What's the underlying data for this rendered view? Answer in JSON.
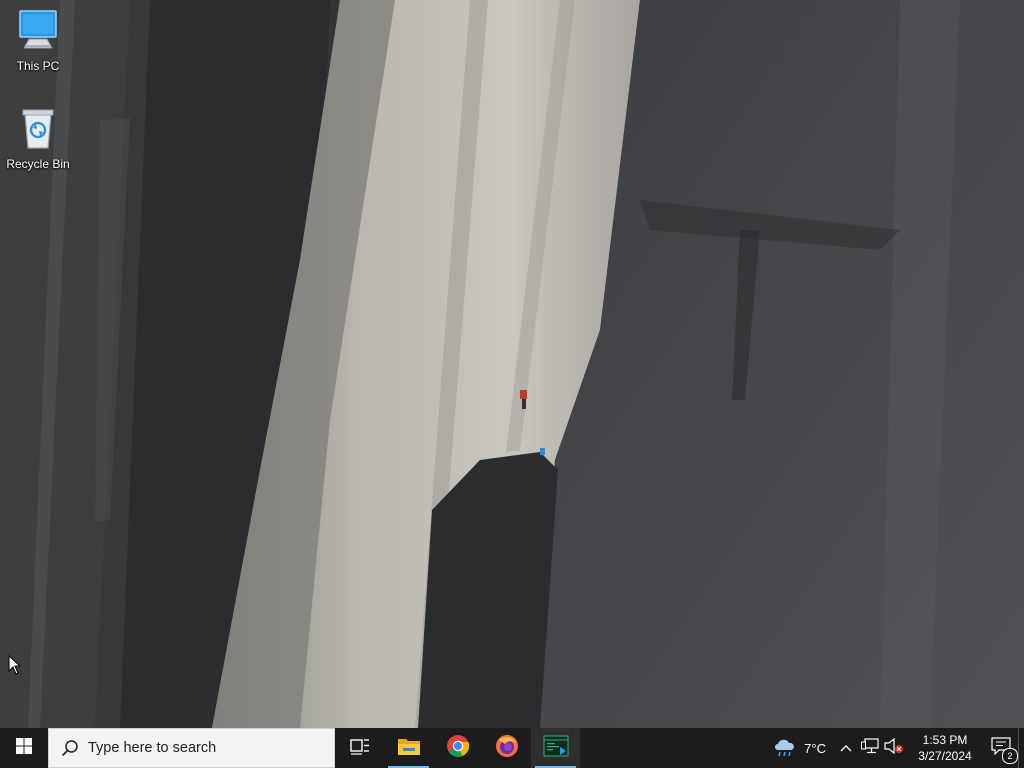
{
  "desktop": {
    "icons": [
      {
        "label": "This PC",
        "icon": "this-pc-icon"
      },
      {
        "label": "Recycle Bin",
        "icon": "recycle-bin-icon"
      }
    ]
  },
  "taskbar": {
    "search_placeholder": "Type here to search",
    "pinned": [
      {
        "name": "task-view",
        "icon": "task-view-icon"
      },
      {
        "name": "file-explorer",
        "icon": "file-explorer-icon",
        "open": true
      },
      {
        "name": "chrome",
        "icon": "chrome-icon"
      },
      {
        "name": "firefox",
        "icon": "firefox-icon"
      },
      {
        "name": "terminal",
        "icon": "terminal-icon",
        "open": true
      }
    ],
    "weather": {
      "temperature": "7°C",
      "icon": "cloud-rain-icon"
    },
    "clock": {
      "time": "1:53 PM",
      "date": "3/27/2024"
    },
    "notifications": {
      "count": "2"
    }
  },
  "colors": {
    "taskbar_bg": "#1c1c1c",
    "accent_underline": "#76b9ed",
    "search_bg": "#f3f3f3"
  }
}
